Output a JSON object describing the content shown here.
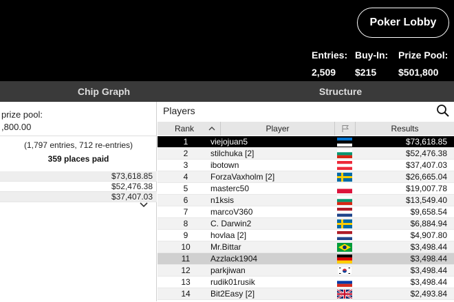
{
  "header": {
    "lobby_button": "Poker Lobby",
    "stats": [
      {
        "label": "Entries:",
        "value": "2,509"
      },
      {
        "label": "Buy-In:",
        "value": "$215"
      },
      {
        "label": "Prize Pool:",
        "value": "$501,800"
      }
    ]
  },
  "tabs": [
    {
      "label": "Chip Graph"
    },
    {
      "label": "Structure"
    }
  ],
  "left": {
    "prize_pool_label": "prize pool:",
    "prize_pool_value": ",800.00",
    "entries_note": "(1,797 entries, 712 re-entries)",
    "places_paid": "359 places paid",
    "prizes": [
      "$73,618.85",
      "$52,476.38",
      "$37,407.03"
    ]
  },
  "players": {
    "title": "Players",
    "columns": {
      "rank": "Rank",
      "player": "Player",
      "results": "Results"
    },
    "rows": [
      {
        "rank": "1",
        "name": "viejojuan5",
        "flag": "estonia",
        "result": "$73,618.85"
      },
      {
        "rank": "2",
        "name": "stilchuka [2]",
        "flag": "bulgaria",
        "result": "$52,476.38"
      },
      {
        "rank": "3",
        "name": "ibotown",
        "flag": "austria",
        "result": "$37,407.03"
      },
      {
        "rank": "4",
        "name": "ForzaVaxholm [2]",
        "flag": "sweden",
        "result": "$26,665.04"
      },
      {
        "rank": "5",
        "name": "masterc50",
        "flag": "poland",
        "result": "$19,007.78"
      },
      {
        "rank": "6",
        "name": "n1ksis",
        "flag": "bulgaria",
        "result": "$13,549.40"
      },
      {
        "rank": "7",
        "name": "marcoV360",
        "flag": "netherlands",
        "result": "$9,658.54"
      },
      {
        "rank": "8",
        "name": "C. Darwin2",
        "flag": "sweden",
        "result": "$6,884.94"
      },
      {
        "rank": "9",
        "name": "hovlaa [2]",
        "flag": "netherlands",
        "result": "$4,907.80"
      },
      {
        "rank": "10",
        "name": "Mr.Bittar",
        "flag": "brazil",
        "result": "$3,498.44"
      },
      {
        "rank": "11",
        "name": "Azzlack1904",
        "flag": "germany",
        "result": "$3,498.44"
      },
      {
        "rank": "12",
        "name": "parkjiwan",
        "flag": "south-korea",
        "result": "$3,498.44"
      },
      {
        "rank": "13",
        "name": "rudik01rusik",
        "flag": "russia",
        "result": "$3,498.44"
      },
      {
        "rank": "14",
        "name": "Bit2Easy [2]",
        "flag": "united-kingdom",
        "result": "$2,493.84"
      }
    ]
  }
}
